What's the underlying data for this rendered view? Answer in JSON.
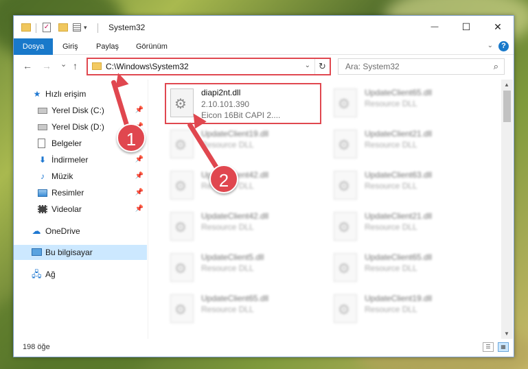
{
  "titlebar": {
    "title": "System32",
    "quick_access_dropdown": "▾",
    "minimize": "—",
    "maximize": "☐",
    "close": "✕"
  },
  "ribbon": {
    "tabs": [
      "Dosya",
      "Giriş",
      "Paylaş",
      "Görünüm"
    ],
    "help": "?"
  },
  "navbar": {
    "back": "←",
    "forward": "→",
    "recent": "⌄",
    "up": "↑",
    "address": "C:\\Windows\\System32",
    "refresh": "↻",
    "search_placeholder": "Ara: System32"
  },
  "sidebar": {
    "items": [
      {
        "label": "Hızlı erişim",
        "icon": "star-icon"
      },
      {
        "label": "Yerel Disk (C:)",
        "icon": "drive-icon"
      },
      {
        "label": "Yerel Disk (D:)",
        "icon": "drive-icon"
      },
      {
        "label": "Belgeler",
        "icon": "document-icon"
      },
      {
        "label": "İndirmeler",
        "icon": "download-icon"
      },
      {
        "label": "Müzik",
        "icon": "music-icon"
      },
      {
        "label": "Resimler",
        "icon": "pictures-icon"
      },
      {
        "label": "Videolar",
        "icon": "video-icon"
      },
      {
        "label": "OneDrive",
        "icon": "cloud-icon"
      },
      {
        "label": "Bu bilgisayar",
        "icon": "computer-icon"
      },
      {
        "label": "Ağ",
        "icon": "network-icon"
      }
    ]
  },
  "files": {
    "highlighted": {
      "name": "diapi2nt.dll",
      "version": "2.10.101.390",
      "description": "Eicon 16Bit CAPI 2...."
    },
    "left_column": [
      {
        "name": "UpdateClient19.dll",
        "type": "Resource DLL"
      },
      {
        "name": "UpdateClient42.dll",
        "type": "Resource DLL"
      },
      {
        "name": "UpdateClient42.dll",
        "type": "Resource DLL"
      },
      {
        "name": "UpdateClient5.dll",
        "type": "Resource DLL"
      },
      {
        "name": "UpdateClient65.dll",
        "type": "Resource DLL"
      }
    ],
    "right_column": [
      {
        "name": "UpdateClient65.dll",
        "type": "Resource DLL"
      },
      {
        "name": "UpdateClient21.dll",
        "type": "Resource DLL"
      },
      {
        "name": "UpdateClient63.dll",
        "type": "Resource DLL"
      },
      {
        "name": "UpdateClient21.dll",
        "type": "Resource DLL"
      },
      {
        "name": "UpdateClient65.dll",
        "type": "Resource DLL"
      },
      {
        "name": "UpdateClient19.dll",
        "type": "Resource DLL"
      }
    ]
  },
  "status": {
    "item_count": "198 öğe"
  },
  "annotations": {
    "badge1": "1",
    "badge2": "2",
    "color": "#e0474f"
  },
  "colors": {
    "accent": "#1979ca",
    "selection": "#cce8ff"
  }
}
